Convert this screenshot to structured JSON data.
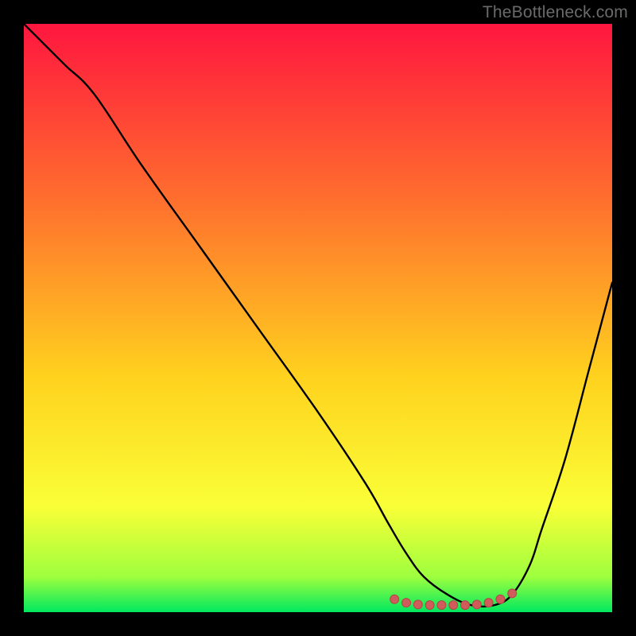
{
  "watermark": "TheBottleneck.com",
  "colors": {
    "gradient_top": "#ff163f",
    "gradient_upper_mid": "#ff6f2e",
    "gradient_mid": "#ffd21e",
    "gradient_lower_mid": "#faff37",
    "gradient_near_bottom": "#9eff3e",
    "gradient_bottom": "#00e85f",
    "curve": "#000000",
    "marker_fill": "#cf5b5b",
    "marker_stroke": "#b24747",
    "background": "#000000"
  },
  "chart_data": {
    "type": "line",
    "title": "",
    "xlabel": "",
    "ylabel": "",
    "xlim": [
      0,
      100
    ],
    "ylim": [
      0,
      100
    ],
    "note": "Axes are unlabeled in source image; values are relative percentages read from pixel grid (0,0 bottom-left).",
    "series": [
      {
        "name": "curve",
        "x": [
          0,
          3,
          7,
          12,
          20,
          30,
          40,
          50,
          58,
          62,
          65,
          68,
          72,
          76,
          80,
          83,
          86,
          88,
          92,
          96,
          100
        ],
        "y": [
          100,
          97,
          93,
          88,
          76,
          62,
          48,
          34,
          22,
          15,
          10,
          6,
          3,
          1.2,
          1.2,
          3,
          8,
          14,
          26,
          41,
          56
        ]
      }
    ],
    "markers": {
      "name": "bottom-cluster",
      "x": [
        63,
        65,
        67,
        69,
        71,
        73,
        75,
        77,
        79,
        81,
        83
      ],
      "y": [
        2.2,
        1.6,
        1.3,
        1.2,
        1.2,
        1.2,
        1.2,
        1.3,
        1.6,
        2.2,
        3.2
      ]
    }
  }
}
